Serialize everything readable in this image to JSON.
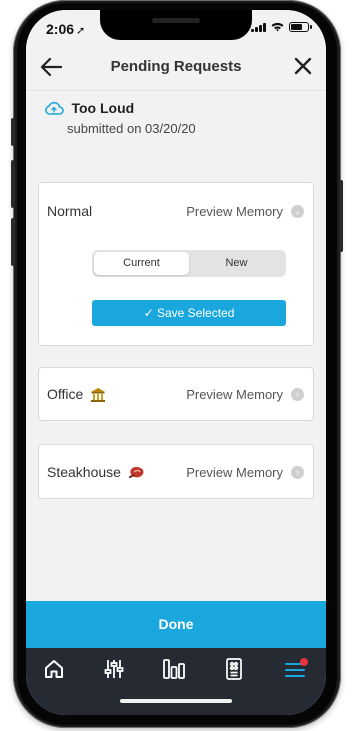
{
  "status_bar": {
    "time": "2:06"
  },
  "nav": {
    "title": "Pending Requests",
    "back_icon": "arrow-left-icon",
    "close_icon": "close-icon"
  },
  "request": {
    "title": "Too Loud",
    "submitted": "submitted on 03/20/20",
    "icon": "cloud-icon"
  },
  "memories": [
    {
      "name": "Normal",
      "preview_label": "Preview Memory",
      "expanded": true,
      "segments": [
        "Current",
        "New"
      ],
      "selected_segment": "Current",
      "save_label": "✓ Save Selected"
    },
    {
      "name": "Office",
      "icon": "bank-icon",
      "preview_label": "Preview Memory"
    },
    {
      "name": "Steakhouse",
      "icon": "steak-icon",
      "preview_label": "Preview Memory"
    }
  ],
  "done_label": "Done",
  "tabs": [
    {
      "name": "home",
      "icon": "home-icon"
    },
    {
      "name": "adjust",
      "icon": "sliders-icon"
    },
    {
      "name": "stats",
      "icon": "bar-chart-icon"
    },
    {
      "name": "remote",
      "icon": "remote-icon"
    },
    {
      "name": "menu",
      "icon": "menu-icon",
      "badge": true
    }
  ],
  "colors": {
    "accent": "#1aa7de",
    "tabbar_bg": "#262a33",
    "badge": "#e8323c"
  }
}
